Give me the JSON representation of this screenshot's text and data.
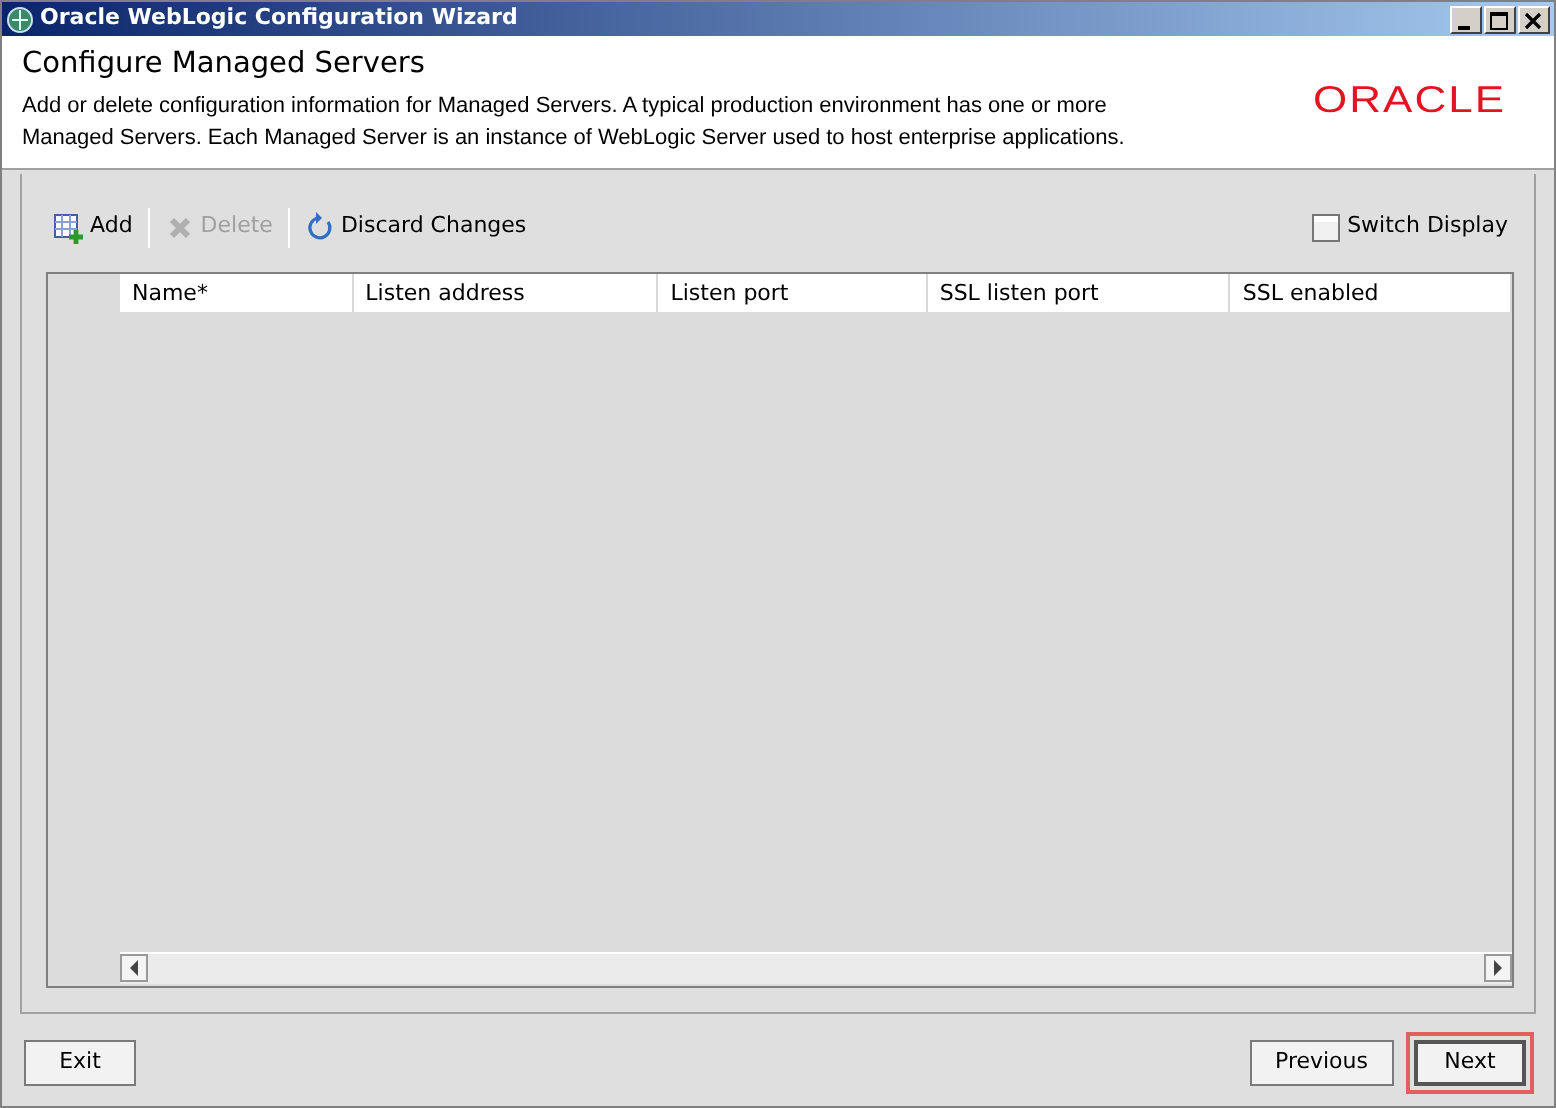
{
  "window": {
    "title": "Oracle WebLogic Configuration Wizard"
  },
  "header": {
    "title": "Configure Managed Servers",
    "description": "Add or delete configuration information for Managed Servers. A typical production environment has one or more Managed Servers. Each Managed Server is an instance of WebLogic Server used to host enterprise applications.",
    "logo": "ORACLE"
  },
  "toolbar": [
    {
      "kind": "add",
      "label": "Add",
      "disabled": false
    },
    {
      "kind": "delete",
      "label": "Delete",
      "disabled": true
    },
    {
      "kind": "discard",
      "label": "Discard Changes",
      "disabled": false
    }
  ],
  "switch_display": {
    "label": "Switch Display"
  },
  "table": {
    "columns": [
      "Name*",
      "Listen address",
      "Listen port",
      "SSL listen port",
      "SSL enabled"
    ]
  },
  "buttons": [
    {
      "label": "Exit",
      "highlighted": false
    },
    {
      "label": "Previous",
      "highlighted": false
    },
    {
      "label": "Next",
      "highlighted": true
    }
  ]
}
